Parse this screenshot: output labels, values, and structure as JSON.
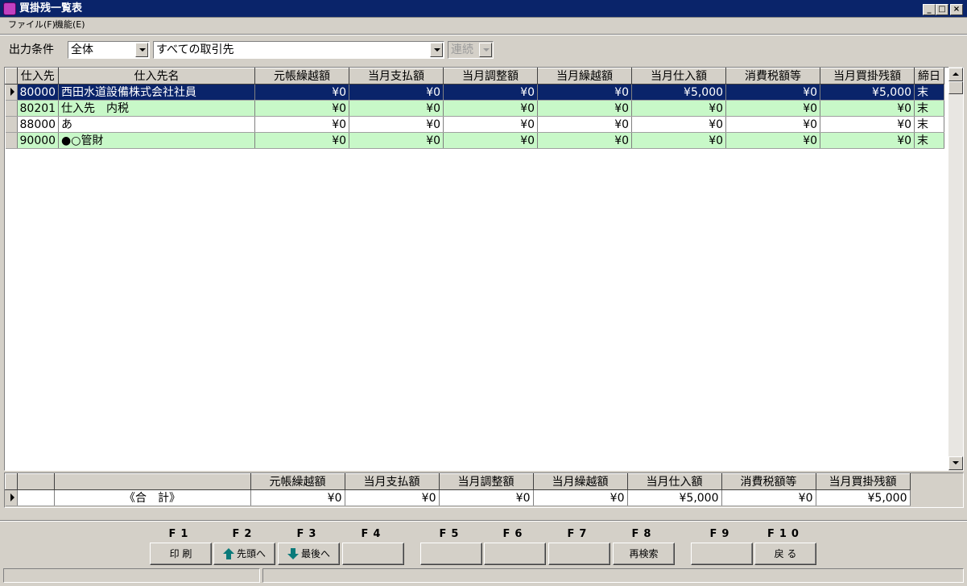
{
  "window": {
    "title": "買掛残一覧表",
    "minimize": "_",
    "maximize": "□",
    "close": "×"
  },
  "menu": {
    "file": "ファイル(F)",
    "function": "機能(E)"
  },
  "filter": {
    "label": "出力条件",
    "scope": "全体",
    "supplier": "すべての取引先",
    "mode": "連続"
  },
  "grid": {
    "columns": [
      "仕入先",
      "仕入先名",
      "元帳繰越額",
      "当月支払額",
      "当月調整額",
      "当月繰越額",
      "当月仕入額",
      "消費税額等",
      "当月買掛残額",
      "締日"
    ],
    "rows": [
      {
        "code": "80000",
        "name": "西田水道設備株式会社社員",
        "ledger": "¥0",
        "paid": "¥0",
        "adjust": "¥0",
        "carry": "¥0",
        "purchase": "¥5,000",
        "tax": "¥0",
        "balance": "¥5,000",
        "close": "末"
      },
      {
        "code": "80201",
        "name": "仕入先　内税",
        "ledger": "¥0",
        "paid": "¥0",
        "adjust": "¥0",
        "carry": "¥0",
        "purchase": "¥0",
        "tax": "¥0",
        "balance": "¥0",
        "close": "末"
      },
      {
        "code": "88000",
        "name": "あ",
        "ledger": "¥0",
        "paid": "¥0",
        "adjust": "¥0",
        "carry": "¥0",
        "purchase": "¥0",
        "tax": "¥0",
        "balance": "¥0",
        "close": "末"
      },
      {
        "code": "90000",
        "name": "●○管財",
        "ledger": "¥0",
        "paid": "¥0",
        "adjust": "¥0",
        "carry": "¥0",
        "purchase": "¥0",
        "tax": "¥0",
        "balance": "¥0",
        "close": "末"
      }
    ]
  },
  "totals": {
    "columns": [
      "元帳繰越額",
      "当月支払額",
      "当月調整額",
      "当月繰越額",
      "当月仕入額",
      "消費税額等",
      "当月買掛残額"
    ],
    "label": "《合　計》",
    "values": [
      "¥0",
      "¥0",
      "¥0",
      "¥0",
      "¥5,000",
      "¥0",
      "¥5,000"
    ]
  },
  "fkeys": [
    {
      "key": "F1",
      "label": "印 刷"
    },
    {
      "key": "F2",
      "label": "先頭へ"
    },
    {
      "key": "F3",
      "label": "最後へ"
    },
    {
      "key": "F4",
      "label": ""
    },
    {
      "key": "F5",
      "label": ""
    },
    {
      "key": "F6",
      "label": ""
    },
    {
      "key": "F7",
      "label": ""
    },
    {
      "key": "F8",
      "label": "再検索"
    },
    {
      "key": "F9",
      "label": ""
    },
    {
      "key": "F10",
      "label": "戻 る"
    }
  ]
}
